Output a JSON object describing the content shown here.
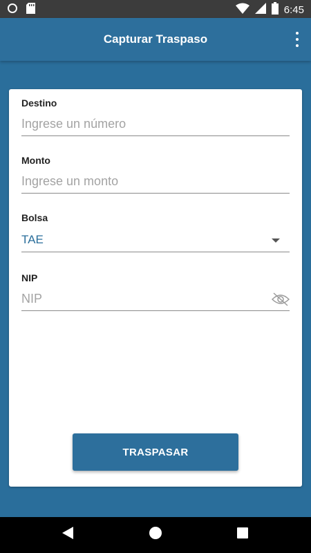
{
  "status_bar": {
    "time": "6:45"
  },
  "appbar": {
    "title": "Capturar Traspaso"
  },
  "form": {
    "destino": {
      "label": "Destino",
      "placeholder": "Ingrese un número",
      "value": ""
    },
    "monto": {
      "label": "Monto",
      "placeholder": "Ingrese un monto",
      "value": ""
    },
    "bolsa": {
      "label": "Bolsa",
      "value": "TAE"
    },
    "nip": {
      "label": "NIP",
      "placeholder": "NIP",
      "value": ""
    }
  },
  "actions": {
    "submit_label": "TRASPASAR"
  },
  "colors": {
    "primary": "#2d6f9c",
    "status_bar": "#3c3c3c",
    "nav_bar": "#000000",
    "accent_text": "#2a6e9b"
  },
  "icons": [
    "sd-card-icon",
    "sim-icon",
    "wifi-icon",
    "signal-icon",
    "battery-icon",
    "more-vert-icon",
    "eye-off-icon",
    "back-icon",
    "home-icon",
    "recents-icon"
  ]
}
